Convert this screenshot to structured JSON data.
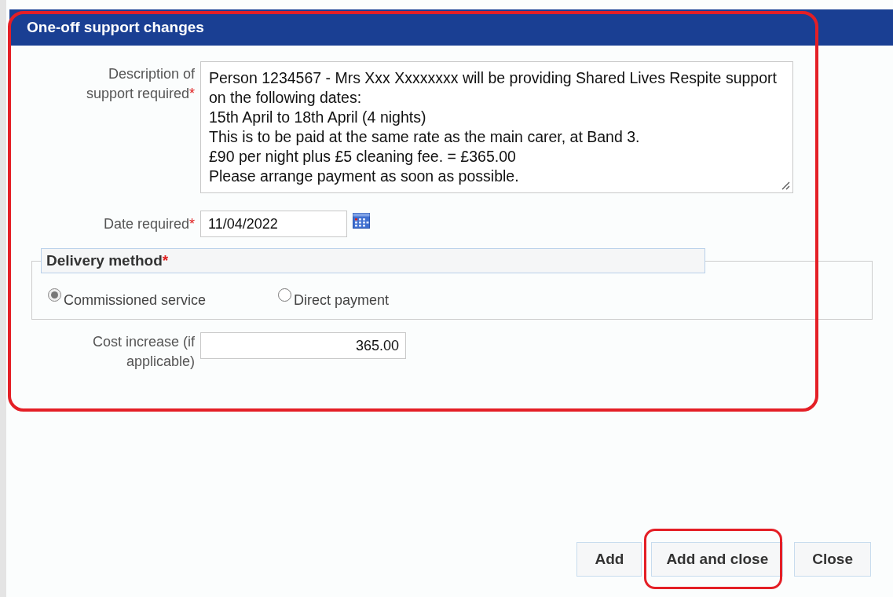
{
  "dialog": {
    "title": "One-off support changes"
  },
  "fields": [
    {
      "label": "Description of support required",
      "required_mark": "*",
      "kind": "textarea",
      "value": [
        "Person 1234567 - Mrs Xxx Xxxxxxxx will be providing Shared Lives Respite support on the following dates:",
        "15th April to 18th April (4 nights)",
        "This is to be paid at the same rate as the main carer, at Band 3.",
        "£90 per night plus £5 cleaning fee. = £365.00",
        "Please arrange payment as soon as possible."
      ]
    },
    {
      "label": "Date required",
      "required_mark": "*",
      "kind": "date",
      "value": "11/04/2022"
    }
  ],
  "delivery": {
    "legend": "Delivery method",
    "required_mark": "*",
    "options": [
      {
        "label": "Commissioned service",
        "selected": true
      },
      {
        "label": "Direct payment",
        "selected": false
      }
    ]
  },
  "cost": {
    "label": "Cost increase (if applicable)",
    "value": "365.00"
  },
  "buttons": [
    {
      "label": "Add",
      "highlighted": false
    },
    {
      "label": "Add and close",
      "highlighted": true
    },
    {
      "label": "Close",
      "highlighted": false
    }
  ],
  "annotation": {
    "form_outlined": true
  }
}
